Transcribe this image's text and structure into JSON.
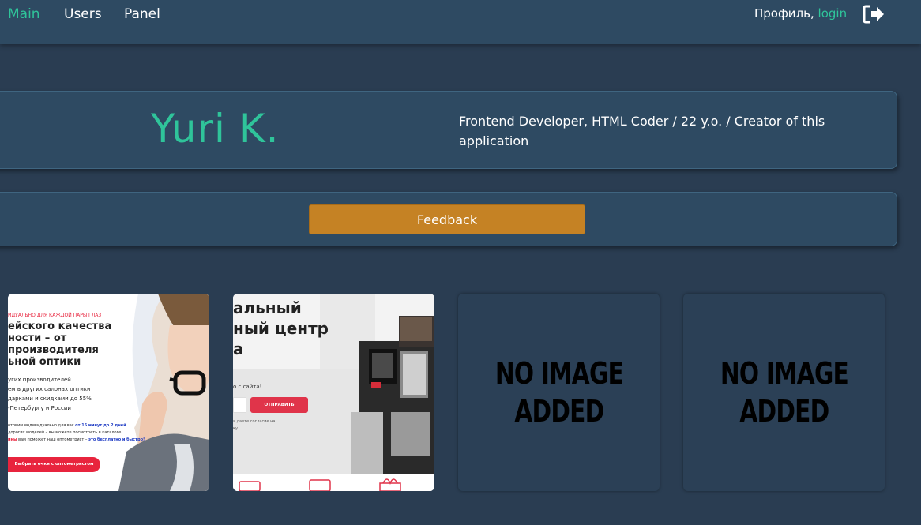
{
  "nav": {
    "main": "Main",
    "users": "Users",
    "panel": "Panel",
    "profile_label": "Профиль,",
    "login": "login"
  },
  "hero": {
    "name": "Yuri K.",
    "description": "Frontend Developer, HTML Coder / 22 y.o. / Creator of this application"
  },
  "feedback": {
    "button_label": "Feedback"
  },
  "gallery": {
    "thumb1": {
      "tag": "ИДУАЛЬНО ДЛЯ КАЖДОЙ ПАРЫ ГЛАЗ",
      "headline": [
        "ейского качества",
        "ности – от",
        "производителя",
        "ьной оптики"
      ],
      "bullets": [
        "угих производителей",
        "ем в других салонах оптики",
        "дарками и скидками до 55%",
        "-Петербургу и России"
      ],
      "fine1a": "отовим индивидуально для вас ",
      "fine1b": "от 15 минут до 2 дней.",
      "fine2": "дорогих моделей – вы можете посмотреть в каталоге.",
      "fine3a": "ины",
      "fine3b": " вам поможет наш оптометрист – ",
      "fine3c": "это бесплатно и быстро!",
      "cta": "Выбрать очки с оптометристом"
    },
    "thumb2": {
      "headline": [
        "альный",
        "ный центр",
        "а"
      ],
      "subtext": "о с сайта!",
      "send_button": "ОТПРАВИТЬ",
      "consent": [
        "я даете согласие на",
        "ку"
      ]
    },
    "noimage_1": [
      "NO IMAGE",
      "ADDED"
    ],
    "noimage_2": [
      "NO IMAGE",
      "ADDED"
    ]
  },
  "colors": {
    "background": "#2a3d52",
    "navbar": "#2e4a62",
    "accent": "#2fc49a",
    "feedback": "#c58224"
  },
  "icons": {
    "logout": "sign-out-icon"
  }
}
